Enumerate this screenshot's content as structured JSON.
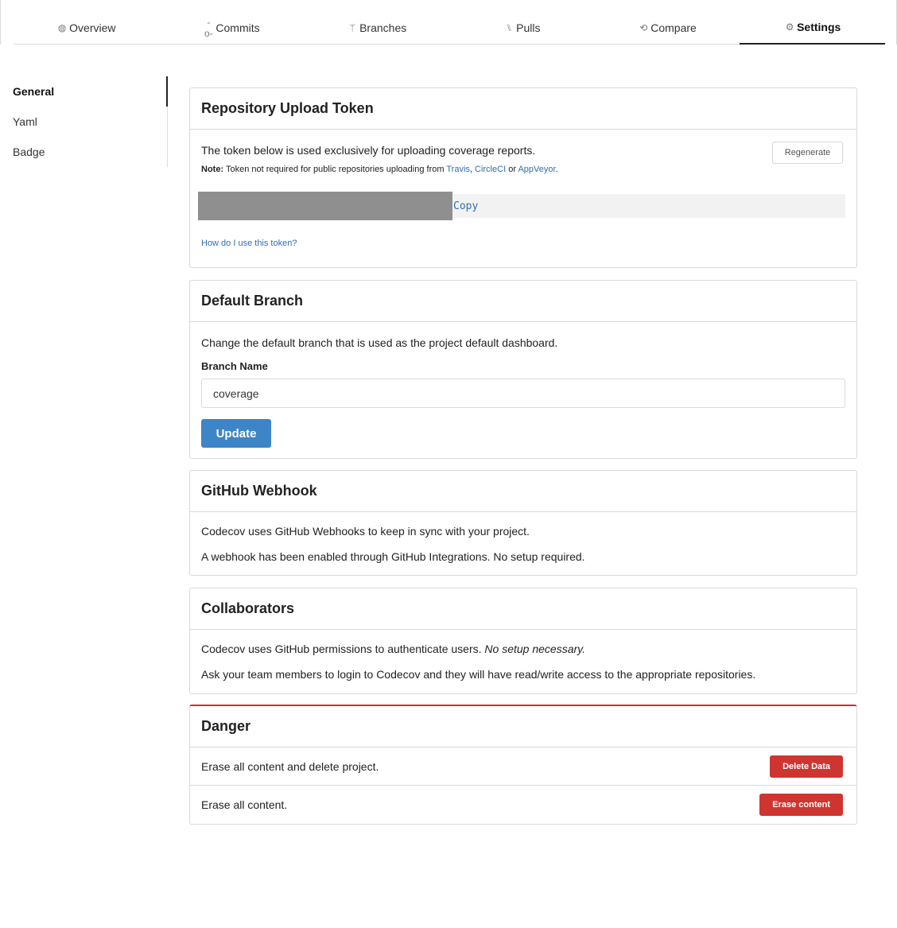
{
  "tabs": [
    {
      "icon": "dashboard-icon",
      "glyph": "◍",
      "label": "Overview"
    },
    {
      "icon": "commit-icon",
      "glyph": "-o-",
      "label": "Commits"
    },
    {
      "icon": "branch-icon",
      "glyph": "ᛘ",
      "label": "Branches"
    },
    {
      "icon": "pull-request-icon",
      "glyph": "⑊",
      "label": "Pulls"
    },
    {
      "icon": "compare-icon",
      "glyph": "⟲",
      "label": "Compare"
    },
    {
      "icon": "gear-icon",
      "glyph": "⚙",
      "label": "Settings"
    }
  ],
  "sidebar": {
    "items": [
      {
        "label": "General"
      },
      {
        "label": "Yaml"
      },
      {
        "label": "Badge"
      }
    ]
  },
  "upload_token": {
    "title": "Repository Upload Token",
    "description": "The token below is used exclusively for uploading coverage reports.",
    "regenerate_label": "Regenerate",
    "note_prefix": "Note:",
    "note_text": " Token not required for public repositories uploading from ",
    "link_travis": "Travis",
    "comma": ", ",
    "link_circleci": "CircleCI",
    "or": " or ",
    "link_appveyor": "AppVeyor",
    "period": ".",
    "copy_label": "Copy",
    "help_link": "How do I use this token?"
  },
  "default_branch": {
    "title": "Default Branch",
    "description": "Change the default branch that is used as the project default dashboard.",
    "field_label": "Branch Name",
    "value": "coverage",
    "update_label": "Update"
  },
  "webhook": {
    "title": "GitHub Webhook",
    "line1": "Codecov uses GitHub Webhooks to keep in sync with your project.",
    "line2": "A webhook has been enabled through GitHub Integrations. No setup required."
  },
  "collaborators": {
    "title": "Collaborators",
    "line1": "Codecov uses GitHub permissions to authenticate users. ",
    "line1_em": "No setup necessary.",
    "line2": "Ask your team members to login to Codecov and they will have read/write access to the appropriate repositories."
  },
  "danger": {
    "title": "Danger",
    "rows": [
      {
        "text": "Erase all content and delete project.",
        "button": "Delete Data"
      },
      {
        "text": "Erase all content.",
        "button": "Erase content"
      }
    ]
  }
}
